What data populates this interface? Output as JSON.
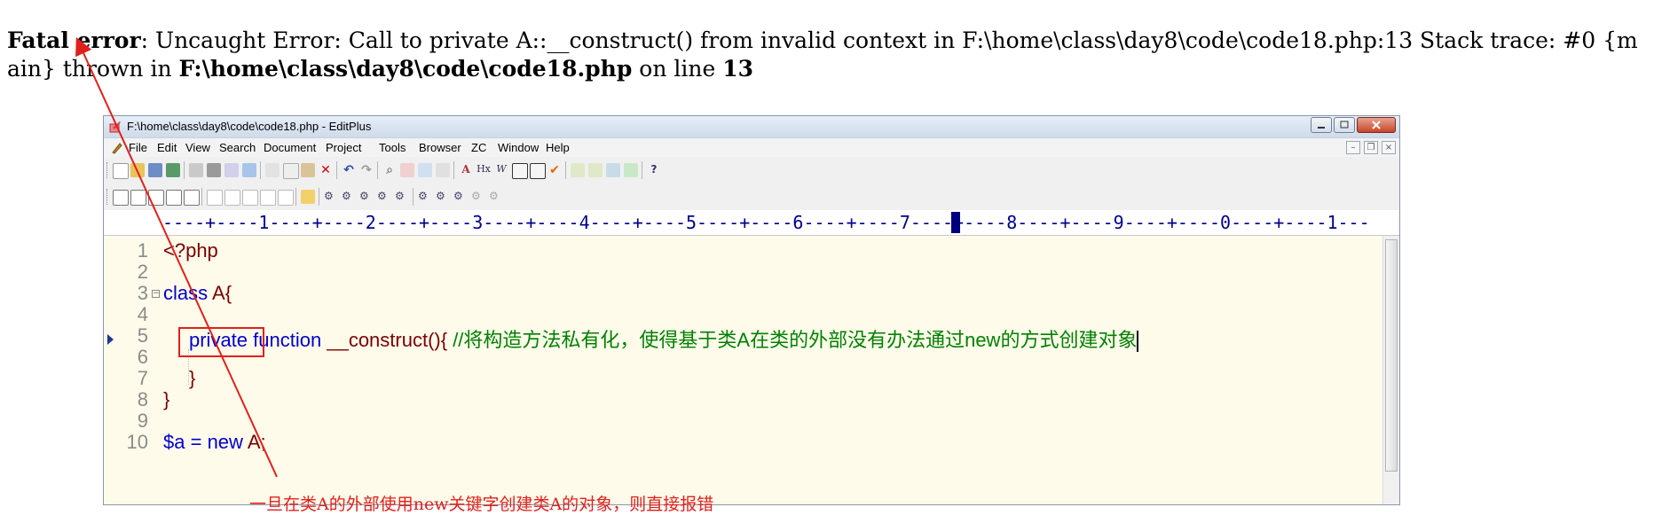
{
  "error": {
    "label": "Fatal error",
    "message": ": Uncaught Error: Call to private A::__construct() from invalid context in F:\\home\\class\\day8\\code\\code18.php:13 Stack trace: #0 {main} thrown in ",
    "file": "F:\\home\\class\\day8\\code\\code18.php",
    "on_line": " on line ",
    "line": "13"
  },
  "window": {
    "title": "F:\\home\\class\\day8\\code\\code18.php - EditPlus"
  },
  "menu": [
    "File",
    "Edit",
    "View",
    "Search",
    "Document",
    "Project",
    "Tools",
    "Browser",
    "ZC",
    "Window",
    "Help"
  ],
  "ruler": {
    "text": "----+----1----+----2----+----3----+----4----+----5----+----6----+----7----+----8----+----9----+----0----+----1---"
  },
  "code": {
    "line_numbers": [
      "1",
      "2",
      "3",
      "4",
      "5",
      "6",
      "7",
      "8",
      "9",
      "10"
    ],
    "l1": "<?php",
    "l3_kw": "class",
    "l3_rest": " A{",
    "l5_kw": "private",
    "l5_fn": "function",
    "l5_name": " __construct(){ ",
    "l5_comment": "//将构造方法私有化，使得基于类A在类的外部没有办法通过new的方式创建对象",
    "l7": "}",
    "l8": "}",
    "l10_var": "$a",
    "l10_eq": " = ",
    "l10_new": "new",
    "l10_rest": " A;"
  },
  "annotation": {
    "note": "一旦在类A的外部使用new关键字创建类A的对象，则直接报错",
    "color": "#e0201c"
  },
  "colors": {
    "keyword": "#0000cc",
    "comment": "#008000",
    "default": "#7a0000",
    "editor_bg": "#fffbea"
  }
}
